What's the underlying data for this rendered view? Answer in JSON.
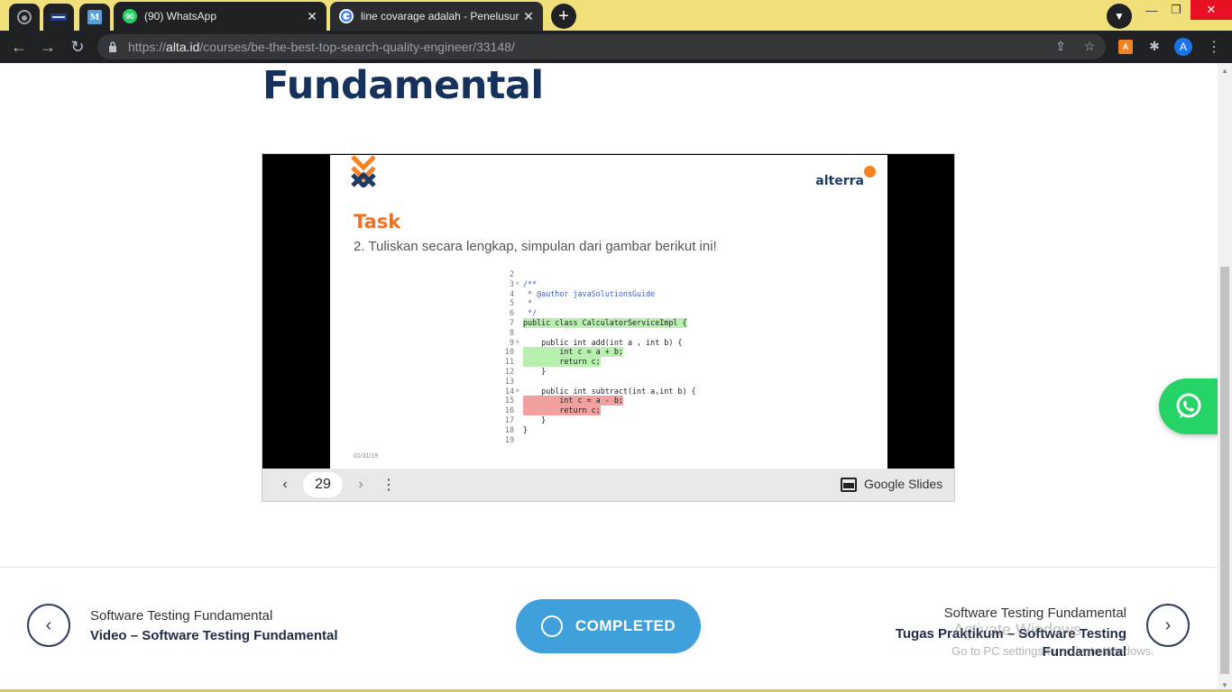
{
  "browser": {
    "tabs": [
      {
        "title": "(90) WhatsApp",
        "favicon_badge": "90"
      },
      {
        "title": "line covarage adalah - Penelusuran"
      }
    ],
    "pinned_tab_m_label": "M",
    "url_scheme": "https://",
    "url_host": "alta.id",
    "url_path": "/courses/be-the-best-top-search-quality-engineer/33148/",
    "profile_initial": "A",
    "extension_label": "A",
    "colors": {
      "tabbar": "#f1e07a",
      "toolbar": "#202124",
      "accent_blue": "#1a73e8"
    }
  },
  "page": {
    "lesson_title": "Fundamental",
    "slide": {
      "brand": "alterra",
      "heading": "Task",
      "instruction": "2. Tuliskan secara lengkap, simpulan dari gambar berikut ini!",
      "date": "01/31/19",
      "code_lines": [
        {
          "n": "2",
          "m": "",
          "text": "",
          "style": ""
        },
        {
          "n": "3",
          "m": "⊖",
          "text": "/**",
          "style": "cmt"
        },
        {
          "n": "4",
          "m": "",
          "text": " * @author javaSolutionsGuide",
          "style": "cmt"
        },
        {
          "n": "5",
          "m": "",
          "text": " *",
          "style": "cmt"
        },
        {
          "n": "6",
          "m": "",
          "text": " */",
          "style": "cmt"
        },
        {
          "n": "7",
          "m": "",
          "text": "public class CalculatorServiceImpl {",
          "style": "green"
        },
        {
          "n": "8",
          "m": "",
          "text": "",
          "style": ""
        },
        {
          "n": "9",
          "m": "⊖",
          "text": "    public int add(int a , int b) {",
          "style": ""
        },
        {
          "n": "10",
          "m": "",
          "text": "        int c = a + b;",
          "style": "green"
        },
        {
          "n": "11",
          "m": "",
          "text": "        return c;",
          "style": "green"
        },
        {
          "n": "12",
          "m": "",
          "text": "    }",
          "style": ""
        },
        {
          "n": "13",
          "m": "",
          "text": "",
          "style": ""
        },
        {
          "n": "14",
          "m": "⊖",
          "text": "    public int subtract(int a,int b) {",
          "style": ""
        },
        {
          "n": "15",
          "m": "",
          "text": "        int c = a - b;",
          "style": "red"
        },
        {
          "n": "16",
          "m": "",
          "text": "        return c;",
          "style": "red"
        },
        {
          "n": "17",
          "m": "",
          "text": "    }",
          "style": ""
        },
        {
          "n": "18",
          "m": "",
          "text": "}",
          "style": ""
        },
        {
          "n": "19",
          "m": "",
          "text": "",
          "style": ""
        }
      ]
    },
    "slides_bar": {
      "page_number": "29",
      "provider_label": "Google Slides"
    },
    "nav_prev": {
      "course": "Software Testing Fundamental",
      "lesson": "Video – Software Testing Fundamental"
    },
    "completed_label": "COMPLETED",
    "nav_next": {
      "course": "Software Testing Fundamental",
      "lesson": "Tugas Praktikum – Software Testing Fundamental"
    },
    "watermark": {
      "line1": "Activate Windows",
      "line2": "Go to PC settings to activate Windows."
    },
    "colors": {
      "title": "#16325c",
      "completed_bg": "#3fa0dc",
      "slide_heading": "#f26f21",
      "whatsapp": "#25d366"
    }
  }
}
